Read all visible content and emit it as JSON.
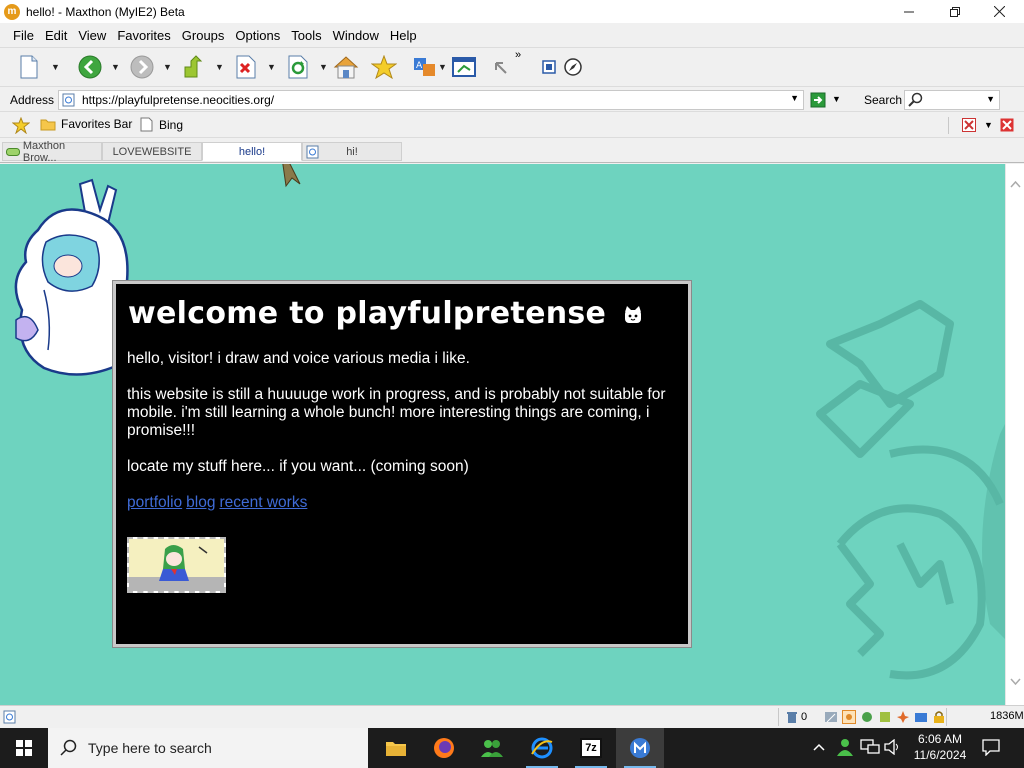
{
  "window": {
    "title": "hello! - Maxthon (MyIE2) Beta",
    "app_icon": "m"
  },
  "menu": [
    "File",
    "Edit",
    "View",
    "Favorites",
    "Groups",
    "Options",
    "Tools",
    "Window",
    "Help"
  ],
  "toolbar": {
    "more": "»"
  },
  "address": {
    "label": "Address",
    "value": "https://playfulpretense.neocities.org/"
  },
  "search": {
    "label": "Search"
  },
  "favorites": {
    "items": [
      "Favorites Bar",
      "Bing"
    ]
  },
  "tabs": [
    {
      "label": "Maxthon Brow...",
      "active": false
    },
    {
      "label": "LOVEWEBSITE",
      "active": false
    },
    {
      "label": "hello!",
      "active": true
    },
    {
      "label": "hi!",
      "active": false
    }
  ],
  "page": {
    "title": "welcome to playfulpretense",
    "intro": "hello, visitor! i draw and voice various media i like.",
    "progress": "this website is still a huuuuge work in progress, and is probably not suitable for mobile. i'm still learning a whole bunch! more interesting things are coming, i promise!!!",
    "locate": "locate my stuff here... if you want... (coming soon)",
    "links": [
      "portfolio",
      "blog",
      "recent works"
    ],
    "background_color": "#6ed3bf"
  },
  "status": {
    "count": "0",
    "memory": "1836M"
  },
  "taskbar": {
    "search_placeholder": "Type here to search",
    "time": "6:06 AM",
    "date": "11/6/2024",
    "seven_zip": "7z"
  }
}
